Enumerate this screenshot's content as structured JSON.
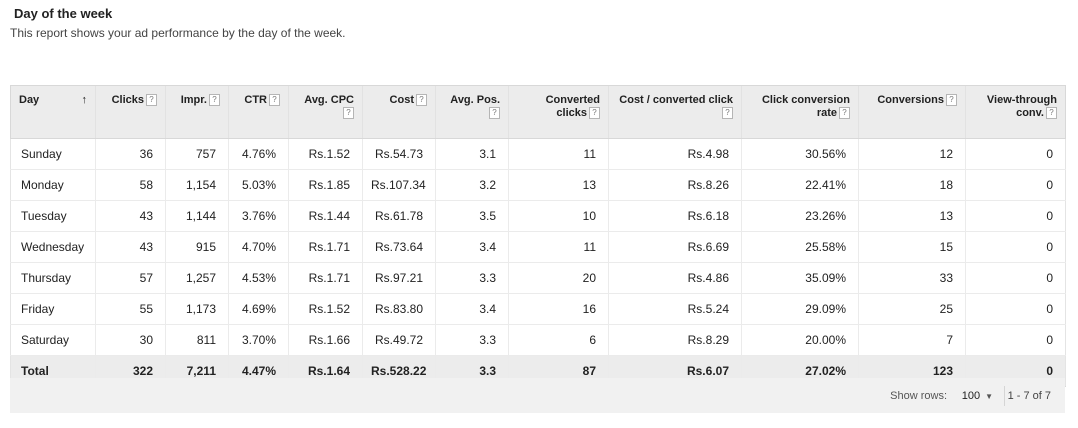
{
  "header": {
    "title": "Day of the week",
    "subtitle": "This report shows your ad performance by the day of the week."
  },
  "table": {
    "columns": [
      {
        "label": "Day",
        "sorted": "ascending"
      },
      {
        "label": "Clicks",
        "help": "?"
      },
      {
        "label": "Impr.",
        "help": "?"
      },
      {
        "label": "CTR",
        "help": "?"
      },
      {
        "label": "Avg. CPC",
        "help": "?"
      },
      {
        "label": "Cost",
        "help": "?"
      },
      {
        "label": "Avg. Pos.",
        "help": "?"
      },
      {
        "label": "Converted clicks",
        "help": "?"
      },
      {
        "label": "Cost / converted click",
        "help": "?"
      },
      {
        "label": "Click conversion rate",
        "help": "?"
      },
      {
        "label": "Conversions",
        "help": "?"
      },
      {
        "label": "View-through conv.",
        "help": "?"
      }
    ],
    "sort_icon": "arrow-up-icon",
    "sort_glyph": "↑",
    "rows": [
      [
        "Sunday",
        "36",
        "757",
        "4.76%",
        "Rs.1.52",
        "Rs.54.73",
        "3.1",
        "11",
        "Rs.4.98",
        "30.56%",
        "12",
        "0"
      ],
      [
        "Monday",
        "58",
        "1,154",
        "5.03%",
        "Rs.1.85",
        "Rs.107.34",
        "3.2",
        "13",
        "Rs.8.26",
        "22.41%",
        "18",
        "0"
      ],
      [
        "Tuesday",
        "43",
        "1,144",
        "3.76%",
        "Rs.1.44",
        "Rs.61.78",
        "3.5",
        "10",
        "Rs.6.18",
        "23.26%",
        "13",
        "0"
      ],
      [
        "Wednesday",
        "43",
        "915",
        "4.70%",
        "Rs.1.71",
        "Rs.73.64",
        "3.4",
        "11",
        "Rs.6.69",
        "25.58%",
        "15",
        "0"
      ],
      [
        "Thursday",
        "57",
        "1,257",
        "4.53%",
        "Rs.1.71",
        "Rs.97.21",
        "3.3",
        "20",
        "Rs.4.86",
        "35.09%",
        "33",
        "0"
      ],
      [
        "Friday",
        "55",
        "1,173",
        "4.69%",
        "Rs.1.52",
        "Rs.83.80",
        "3.4",
        "16",
        "Rs.5.24",
        "29.09%",
        "25",
        "0"
      ],
      [
        "Saturday",
        "30",
        "811",
        "3.70%",
        "Rs.1.66",
        "Rs.49.72",
        "3.3",
        "6",
        "Rs.8.29",
        "20.00%",
        "7",
        "0"
      ]
    ],
    "total": [
      "Total",
      "322",
      "7,211",
      "4.47%",
      "Rs.1.64",
      "Rs.528.22",
      "3.3",
      "87",
      "Rs.6.07",
      "27.02%",
      "123",
      "0"
    ]
  },
  "footer": {
    "show_rows_label": "Show rows:",
    "rows_value": "100",
    "caret_icon": "caret-down-icon",
    "caret_glyph": "▼",
    "range": "1 - 7 of 7"
  }
}
